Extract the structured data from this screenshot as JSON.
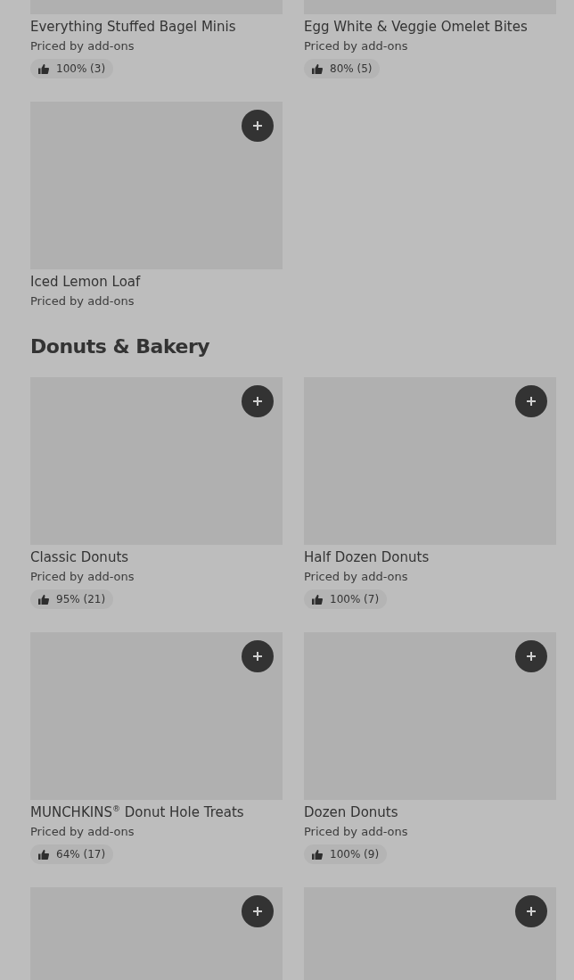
{
  "sections": [
    {
      "items": [
        {
          "kind": "item_image_cut",
          "title": "Everything Stuffed Bagel Minis",
          "price": "Priced by add-ons",
          "rating": "100% (3)"
        },
        {
          "kind": "item_image_cut",
          "title": "Egg White & Veggie Omelet Bites",
          "price": "Priced by add-ons",
          "rating": "80% (5)"
        },
        {
          "kind": "item",
          "title": "Iced Lemon Loaf",
          "price": "Priced by add-ons"
        }
      ]
    },
    {
      "heading": "Donuts & Bakery",
      "items": [
        {
          "kind": "item",
          "title": "Classic Donuts",
          "price": "Priced by add-ons",
          "rating": "95% (21)"
        },
        {
          "kind": "item",
          "title": "Half Dozen Donuts",
          "price": "Priced by add-ons",
          "rating": "100% (7)"
        },
        {
          "kind": "item",
          "title": "MUNCHKINS$^{®}$ Donut Hole Treats",
          "price": "Priced by add-ons",
          "rating": "64% (17)"
        },
        {
          "kind": "item",
          "title": "Dozen Donuts",
          "price": "Priced by add-ons",
          "rating": "100% (9)"
        },
        {
          "kind": "image_only"
        },
        {
          "kind": "image_only"
        }
      ]
    }
  ]
}
